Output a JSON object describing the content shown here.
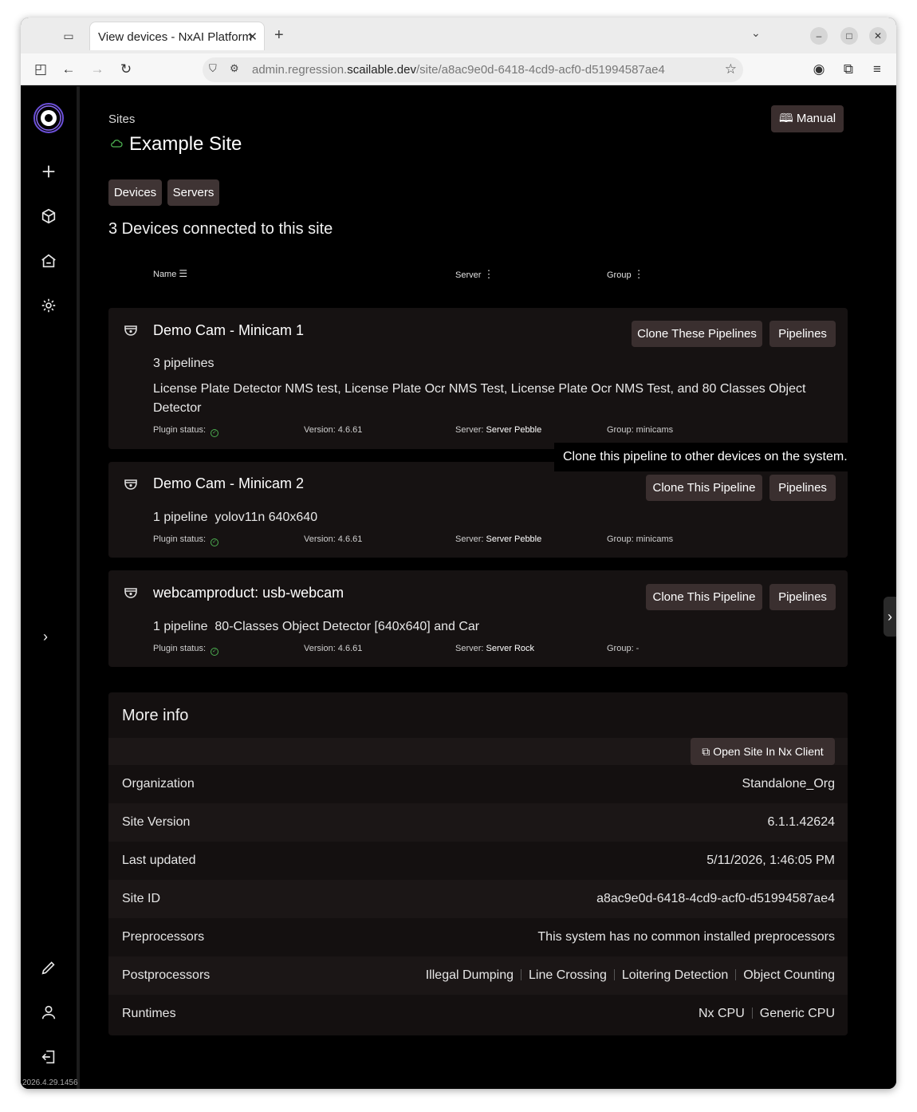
{
  "browser": {
    "tab_title": "View devices - NxAI Platform",
    "url_prefix": "admin.regression.",
    "url_domain": "scailable.dev",
    "url_path": "/site/a8ac9e0d-6418-4cd9-acf0-d51994587ae4"
  },
  "header": {
    "breadcrumb": "Sites",
    "site_title": "Example Site",
    "manual_label": "Manual"
  },
  "chips": {
    "devices": "Devices",
    "servers": "Servers"
  },
  "devices_heading": "3 Devices connected to this site",
  "columns": {
    "name": "Name",
    "server": "Server",
    "group": "Group"
  },
  "devices": [
    {
      "name": "Demo Cam - Minicam 1",
      "clone_label": "Clone These Pipelines",
      "pipelines_label": "Pipelines",
      "pipeline_count": "3 pipelines",
      "pipeline_list": "License Plate Detector NMS test, License Plate Ocr NMS Test, License Plate Ocr NMS Test, and 80 Classes Object Detector",
      "plugin_status": "Plugin status:",
      "version": "Version: 4.6.61",
      "server_label": "Server:",
      "server": "Server Pebble",
      "group": "Group: minicams"
    },
    {
      "name": "Demo Cam - Minicam 2",
      "clone_label": "Clone This Pipeline",
      "pipelines_label": "Pipelines",
      "pipeline_count": "1 pipeline",
      "pipeline_list": "yolov11n 640x640",
      "plugin_status": "Plugin status:",
      "version": "Version: 4.6.61",
      "server_label": "Server:",
      "server": "Server Pebble",
      "group": "Group: minicams"
    },
    {
      "name": "webcamproduct: usb-webcam",
      "clone_label": "Clone This Pipeline",
      "pipelines_label": "Pipelines",
      "pipeline_count": "1 pipeline",
      "pipeline_list": "80-Classes Object Detector [640x640] and Car",
      "plugin_status": "Plugin status:",
      "version": "Version: 4.6.61",
      "server_label": "Server:",
      "server": "Server Rock",
      "group": "Group: -"
    }
  ],
  "tooltip": "Clone this pipeline to other devices on the system.",
  "more_info": {
    "title": "More info",
    "open_site_label": "Open Site In Nx Client",
    "rows": [
      {
        "label": "Organization",
        "value": "Standalone_Org"
      },
      {
        "label": "Site Version",
        "value": "6.1.1.42624"
      },
      {
        "label": "Last updated",
        "value": "5/11/2026, 1:46:05 PM"
      },
      {
        "label": "Site ID",
        "value": "a8ac9e0d-6418-4cd9-acf0-d51994587ae4"
      },
      {
        "label": "Preprocessors",
        "value": "This system has no common installed preprocessors"
      }
    ],
    "postprocessors_label": "Postprocessors",
    "postprocessors": [
      "Illegal Dumping",
      "Line Crossing",
      "Loitering Detection",
      "Object Counting"
    ],
    "runtimes_label": "Runtimes",
    "runtimes": [
      "Nx CPU",
      "Generic CPU"
    ]
  },
  "app_version": "2026.4.29.1456"
}
